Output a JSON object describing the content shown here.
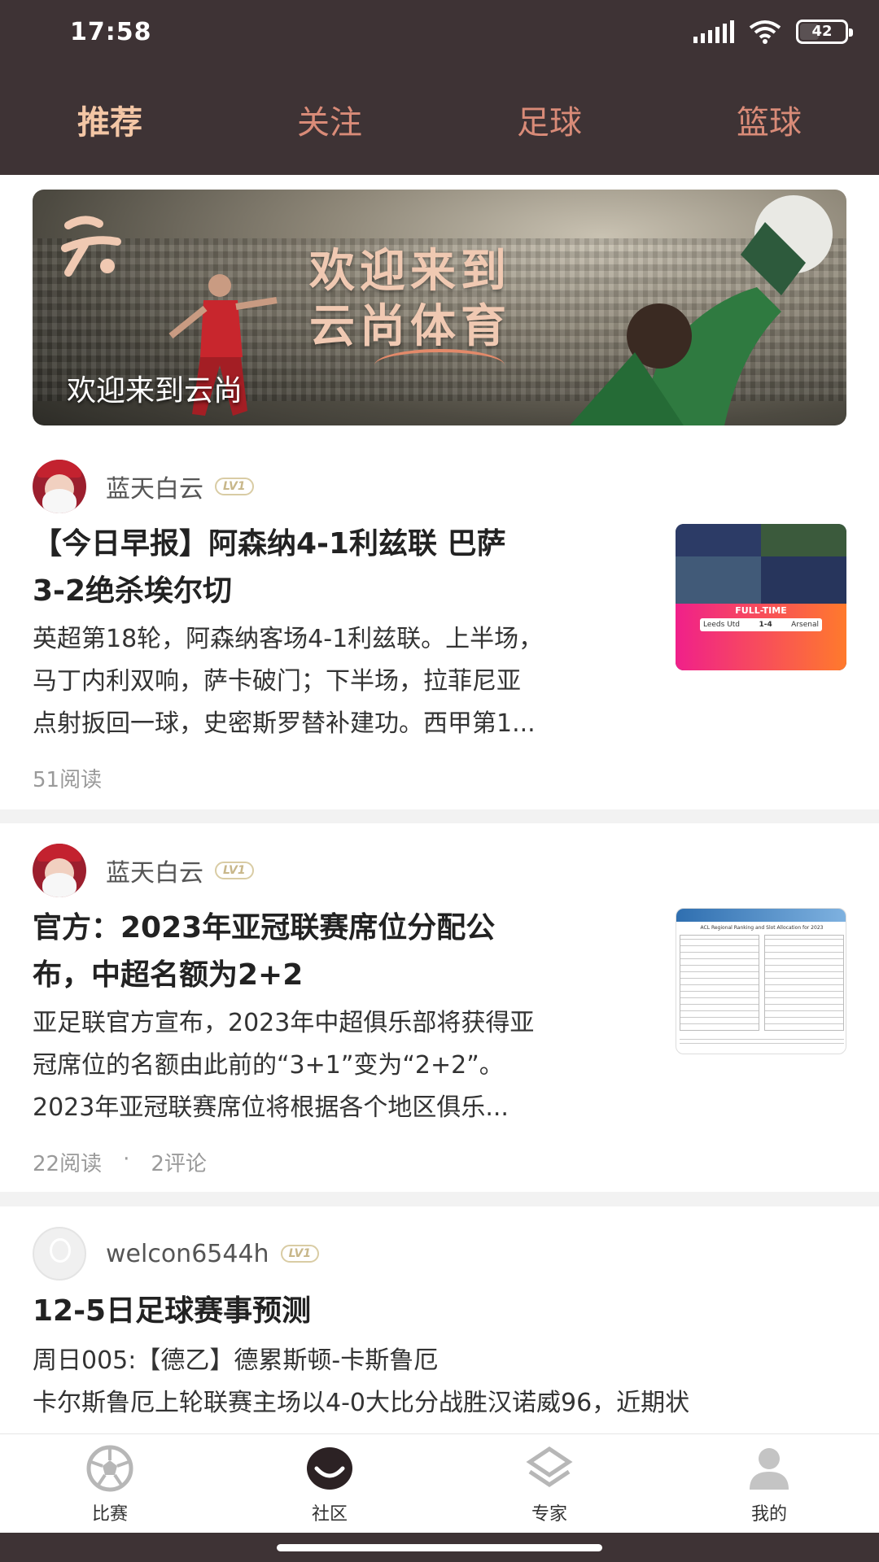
{
  "status_bar": {
    "time": "17:58",
    "battery": "42"
  },
  "tabs": [
    {
      "label": "推荐",
      "active": true
    },
    {
      "label": "关注",
      "active": false
    },
    {
      "label": "足球",
      "active": false
    },
    {
      "label": "篮球",
      "active": false
    }
  ],
  "banner": {
    "title_line1": "欢迎来到",
    "title_line2": "云尚体育",
    "caption": "欢迎来到云尚"
  },
  "posts": [
    {
      "author": "蓝天白云",
      "level": "LV1",
      "title_lines": [
        "【今日早报】阿森纳4-1利兹联 巴萨",
        "3-2绝杀埃尔切"
      ],
      "summary_lines": [
        "英超第18轮，阿森纳客场4-1利兹联。上半场，",
        "马丁内利双响，萨卡破门；下半场，拉菲尼亚",
        "点射扳回一球，史密斯罗替补建功。西甲第1..."
      ],
      "reads": "51阅读",
      "thumb_label": "FULL-TIME",
      "thumb_score": "1-4",
      "thumb_home": "Leeds Utd",
      "thumb_away": "Arsenal"
    },
    {
      "author": "蓝天白云",
      "level": "LV1",
      "title_lines": [
        "官方：2023年亚冠联赛席位分配公",
        "布，中超名额为2+2"
      ],
      "summary_lines": [
        "亚足联官方宣布，2023年中超俱乐部将获得亚",
        "冠席位的名额由此前的“3+1”变为“2+2”。",
        "2023年亚冠联赛席位将根据各个地区俱乐..."
      ],
      "reads": "22阅读",
      "dot": "·",
      "comments": "2评论",
      "thumb_label": "ACL Regional Ranking and Slot Allocation for 2023"
    },
    {
      "author": "welcon6544h",
      "level": "LV1",
      "title": "12-5日足球赛事预测",
      "summary_lines": [
        "周日005:【德乙】德累斯顿-卡斯鲁厄",
        "卡尔斯鲁厄上轮联赛主场以4-0大比分战胜汉诺威96，近期状"
      ]
    }
  ],
  "bottom_nav": [
    {
      "label": "比赛",
      "icon": "soccer-ball-icon"
    },
    {
      "label": "社区",
      "icon": "community-icon"
    },
    {
      "label": "专家",
      "icon": "expert-layers-icon"
    },
    {
      "label": "我的",
      "icon": "profile-icon"
    }
  ],
  "colors": {
    "header_bg": "#3e3335",
    "tab_inactive": "#d98b78",
    "tab_active": "#f3c6a5"
  }
}
